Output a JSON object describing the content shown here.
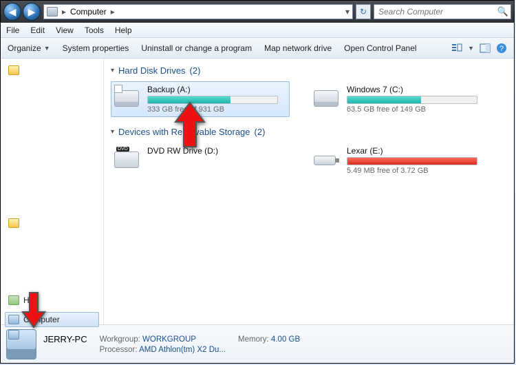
{
  "address": {
    "root": "Computer"
  },
  "search": {
    "placeholder": "Search Computer"
  },
  "menu": {
    "file": "File",
    "edit": "Edit",
    "view": "View",
    "tools": "Tools",
    "help": "Help"
  },
  "toolbar": {
    "organize": "Organize",
    "sysprops": "System properties",
    "uninstall": "Uninstall or change a program",
    "mapdrive": "Map network drive",
    "controlpanel": "Open Control Panel"
  },
  "sidebar": {
    "homegroup": "Ho",
    "computer": "Computer"
  },
  "groups": {
    "hdd_label": "Hard Disk Drives",
    "hdd_count": "(2)",
    "removable_label": "Devices with Removable Storage",
    "removable_count": "(2)"
  },
  "drives": {
    "backup": {
      "name": "Backup (A:)",
      "free": "333 GB free of 931 GB",
      "fill_pct": 64,
      "color": "teal"
    },
    "win7": {
      "name": "Windows 7 (C:)",
      "free": "63.5 GB free of 149 GB",
      "fill_pct": 57,
      "color": "teal"
    },
    "dvd": {
      "name": "DVD RW Drive (D:)"
    },
    "lexar": {
      "name": "Lexar (E:)",
      "free": "5.49 MB free of 3.72 GB",
      "fill_pct": 100,
      "color": "red"
    }
  },
  "details": {
    "pcname": "JERRY-PC",
    "workgroup_lab": "Workgroup:",
    "workgroup_val": "WORKGROUP",
    "memory_lab": "Memory:",
    "memory_val": "4.00 GB",
    "processor_lab": "Processor:",
    "processor_val": "AMD Athlon(tm) X2 Du..."
  }
}
